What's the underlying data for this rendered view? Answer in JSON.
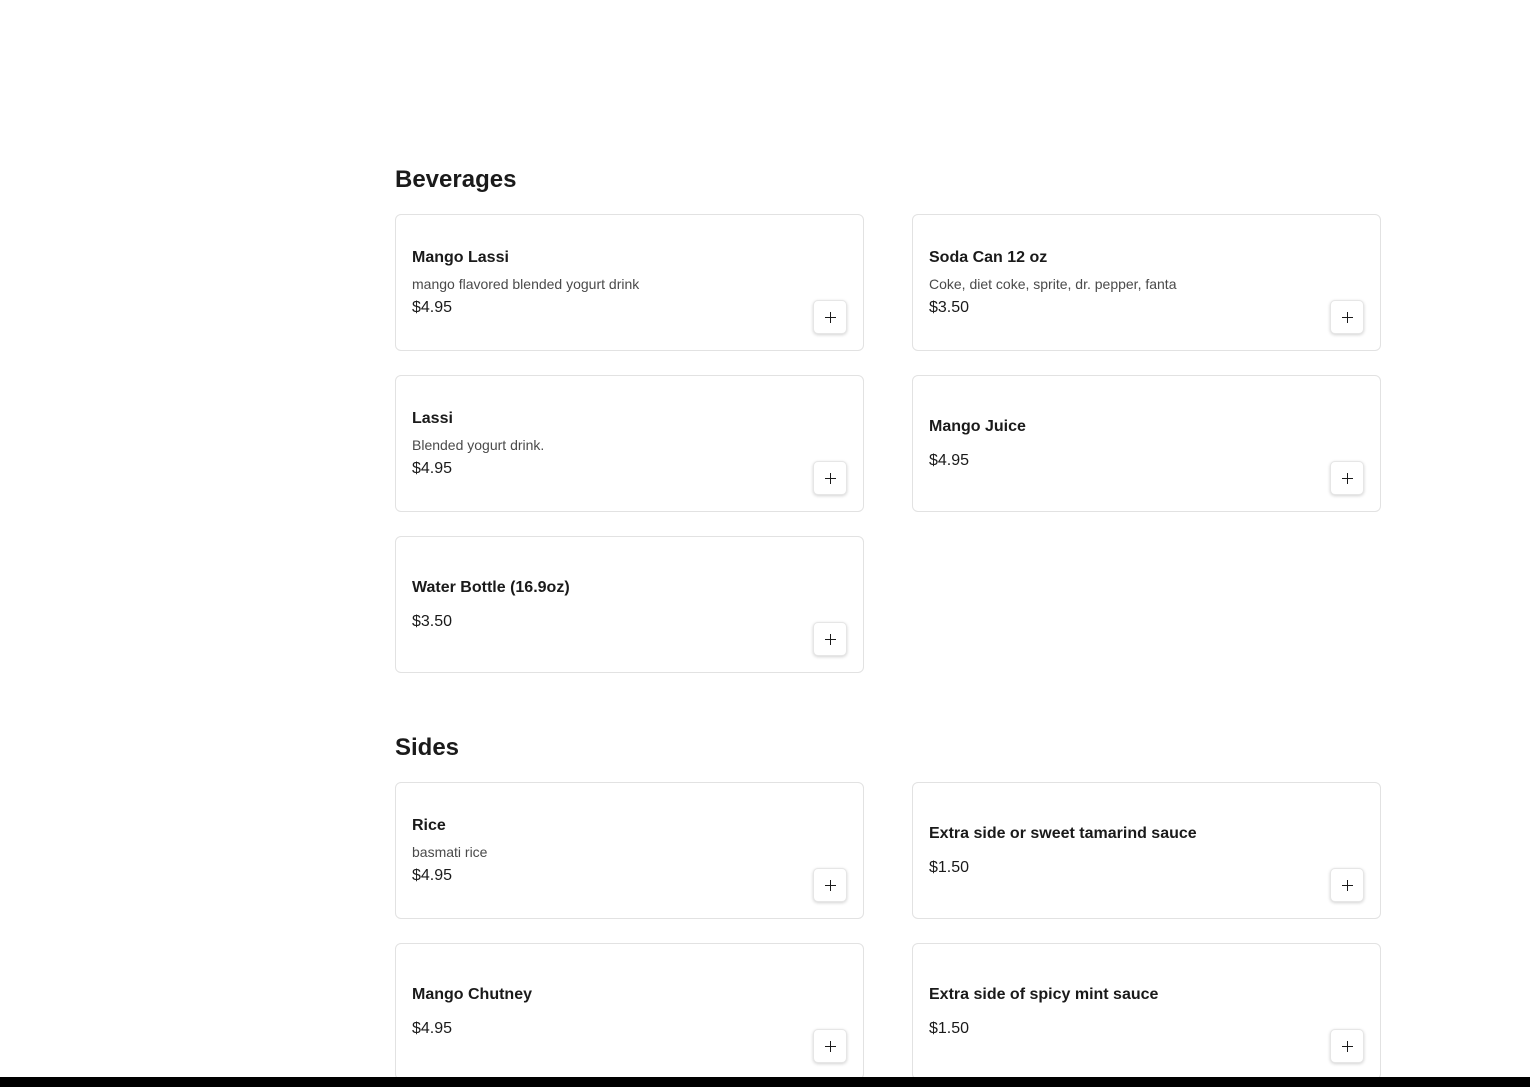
{
  "sections": [
    {
      "title": "Beverages",
      "items": [
        {
          "name": "Mango Lassi",
          "description": "mango flavored blended yogurt drink",
          "price": "$4.95"
        },
        {
          "name": "Soda Can 12 oz",
          "description": "Coke, diet coke, sprite, dr. pepper, fanta",
          "price": "$3.50"
        },
        {
          "name": "Lassi",
          "description": "Blended yogurt drink.",
          "price": "$4.95"
        },
        {
          "name": "Mango Juice",
          "description": "",
          "price": "$4.95"
        },
        {
          "name": "Water Bottle (16.9oz)",
          "description": "",
          "price": "$3.50"
        }
      ]
    },
    {
      "title": "Sides",
      "items": [
        {
          "name": "Rice",
          "description": "basmati rice",
          "price": "$4.95"
        },
        {
          "name": "Extra side or sweet tamarind sauce",
          "description": "",
          "price": "$1.50"
        },
        {
          "name": "Mango Chutney",
          "description": "",
          "price": "$4.95"
        },
        {
          "name": "Extra side of spicy mint sauce",
          "description": "",
          "price": "$1.50"
        }
      ]
    }
  ],
  "icons": {
    "add": "plus-icon"
  }
}
